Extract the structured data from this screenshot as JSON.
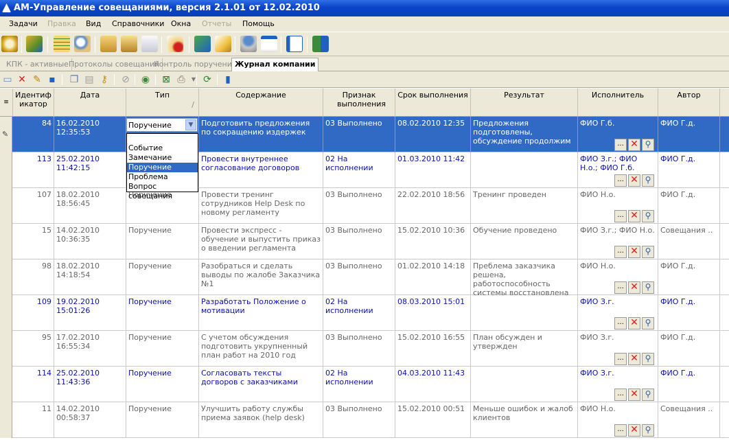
{
  "title": "АМ-Управление совещаниями, версия 2.1.01 от 12.02.2010",
  "menu": [
    "Задачи",
    "Правка",
    "Вид",
    "Справочники",
    "Окна",
    "Отчеты",
    "Помощь"
  ],
  "tabs": [
    "КПК - активные",
    "Протоколы совещаний",
    "Контроль поручений",
    "Журнал компании"
  ],
  "columns": [
    "Идентиф икатор",
    "Дата",
    "Тип",
    "Содержание",
    "Признак выполнения",
    "Срок выполнения",
    "Результат",
    "Исполнитель",
    "Автор"
  ],
  "sort_indicator": "/",
  "combo": {
    "value": "Поручение",
    "options": [
      "Событие",
      "Замечание",
      "Поручение",
      "Проблема",
      "Вопрос совещания"
    ],
    "selected": "Поручение"
  },
  "rows": [
    {
      "id": "84",
      "date": "16.02.2010",
      "time": "12:35:53",
      "type": "",
      "content": "Подготовить предложения по сокращению издержек",
      "status": "03 Выполнено",
      "deadline": "08.02.2010 12:35",
      "result": "Предложения подготовлены, обсуждение продолжим",
      "executor": "ФИО Г.б.",
      "author": "ФИО Г.д.",
      "style": "selected"
    },
    {
      "id": "113",
      "date": "25.02.2010",
      "time": "11:42:15",
      "type": "",
      "content": "Провести внутреннее согласование договоров",
      "status": "02 На исполнении",
      "deadline": "01.03.2010 11:42",
      "result": "",
      "executor": "ФИО З.г.; ФИО Н.о.; ФИО Г.б.",
      "author": "ФИО Г.д.",
      "style": "blue"
    },
    {
      "id": "107",
      "date": "18.02.2010",
      "time": "18:56:45",
      "type": "Поручение",
      "content": "Провести тренинг сотрудников Help Desk по новому регламенту",
      "status": "03 Выполнено",
      "deadline": "22.02.2010 18:56",
      "result": "Тренинг проведен",
      "executor": "ФИО Н.о.",
      "author": "ФИО Г.д.",
      "style": "normal"
    },
    {
      "id": "15",
      "date": "14.02.2010",
      "time": "10:36:35",
      "type": "Поручение",
      "content": "Провести экспресс - обучение и выпустить приказ о введении регламента",
      "status": "03 Выполнено",
      "deadline": "15.02.2010 10:36",
      "result": "Обучение проведено",
      "executor": "ФИО З.г.; ФИО Н.о.",
      "author": "Совещания ..",
      "style": "normal"
    },
    {
      "id": "98",
      "date": "18.02.2010",
      "time": "14:18:54",
      "type": "Поручение",
      "content": "Разобраться и сделать выводы по жалобе Заказчика №1",
      "status": "03 Выполнено",
      "deadline": "01.02.2010 14:18",
      "result": "Преблема заказчика решена, работоспособность системы восстановлена",
      "executor": "ФИО Н.о.",
      "author": "ФИО Г.д.",
      "style": "normal"
    },
    {
      "id": "109",
      "date": "19.02.2010",
      "time": "15:01:26",
      "type": "Поручение",
      "content": "Разработать Положение о мотивации",
      "status": "02 На исполнении",
      "deadline": "08.03.2010 15:01",
      "result": "",
      "executor": "ФИО З.г.",
      "author": "ФИО Г.д.",
      "style": "blue"
    },
    {
      "id": "95",
      "date": "17.02.2010",
      "time": "16:55:34",
      "type": "Поручение",
      "content": "С учетом обсуждения подготовить укрупненный  план работ на 2010 год",
      "status": "03 Выполнено",
      "deadline": "15.02.2010 16:55",
      "result": "План обсужден и утвержден",
      "executor": "ФИО З.г.",
      "author": "ФИО Г.д.",
      "style": "normal"
    },
    {
      "id": "114",
      "date": "25.02.2010",
      "time": "11:43:36",
      "type": "Поручение",
      "content": "Согласовать тексты догворов с заказчиками",
      "status": "02 На исполнении",
      "deadline": "04.03.2010 11:43",
      "result": "",
      "executor": "ФИО З.г.",
      "author": "ФИО Г.д.",
      "style": "blue"
    },
    {
      "id": "11",
      "date": "14.02.2010",
      "time": "00:58:37",
      "type": "Поручение",
      "content": "Улучшить работу службы приема заявок (help desk)",
      "status": "03 Выполнено",
      "deadline": "15.02.2010 00:51",
      "result": "Меньше ошибок и жалоб клиентов",
      "executor": "ФИО Н.о.",
      "author": "Совещания ..",
      "style": "normal"
    }
  ],
  "colors": {
    "title_bar": "#0a44c8",
    "selection": "#316ac5",
    "active_row_text": "#0b0fb0",
    "chrome": "#ece9d8"
  }
}
